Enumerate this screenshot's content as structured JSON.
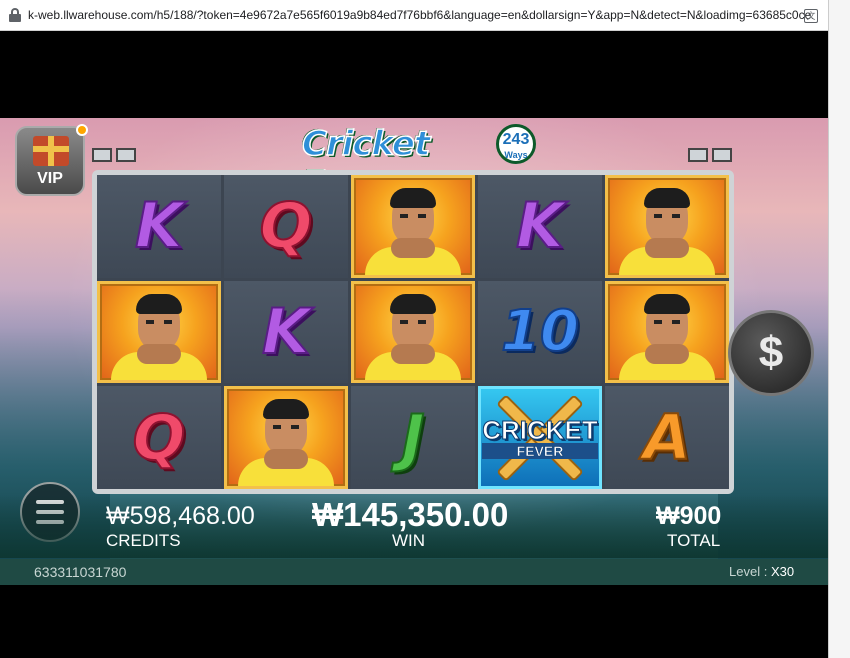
{
  "browser": {
    "url": "k-web.llwarehouse.com/h5/188/?token=4e9672a7e565f6019a9b84ed7f76bbf6&language=en&dollarsign=Y&app=N&detect=N&loadimg=63685c0ce..."
  },
  "game": {
    "logo_text": "Cricket Fever",
    "logo_ways_number": "243",
    "logo_ways_label": "Ways",
    "vip_label": "VIP",
    "spin_symbol": "$",
    "reels": [
      [
        "K",
        "player",
        "Q"
      ],
      [
        "Q",
        "K",
        "player"
      ],
      [
        "player",
        "player",
        "J"
      ],
      [
        "K",
        "10",
        "wild"
      ],
      [
        "player",
        "player",
        "A"
      ]
    ],
    "wild_label_top": "CRICKET",
    "wild_label_bottom": "FEVER"
  },
  "stats": {
    "credits_value": "₩598,468.00",
    "credits_label": "CREDITS",
    "win_value": "₩145,350.00",
    "win_label": "WIN",
    "total_value": "₩900",
    "total_label": "TOTAL"
  },
  "status": {
    "round_id": "633311031780",
    "level_label": "Level :",
    "level_value": "X30"
  }
}
